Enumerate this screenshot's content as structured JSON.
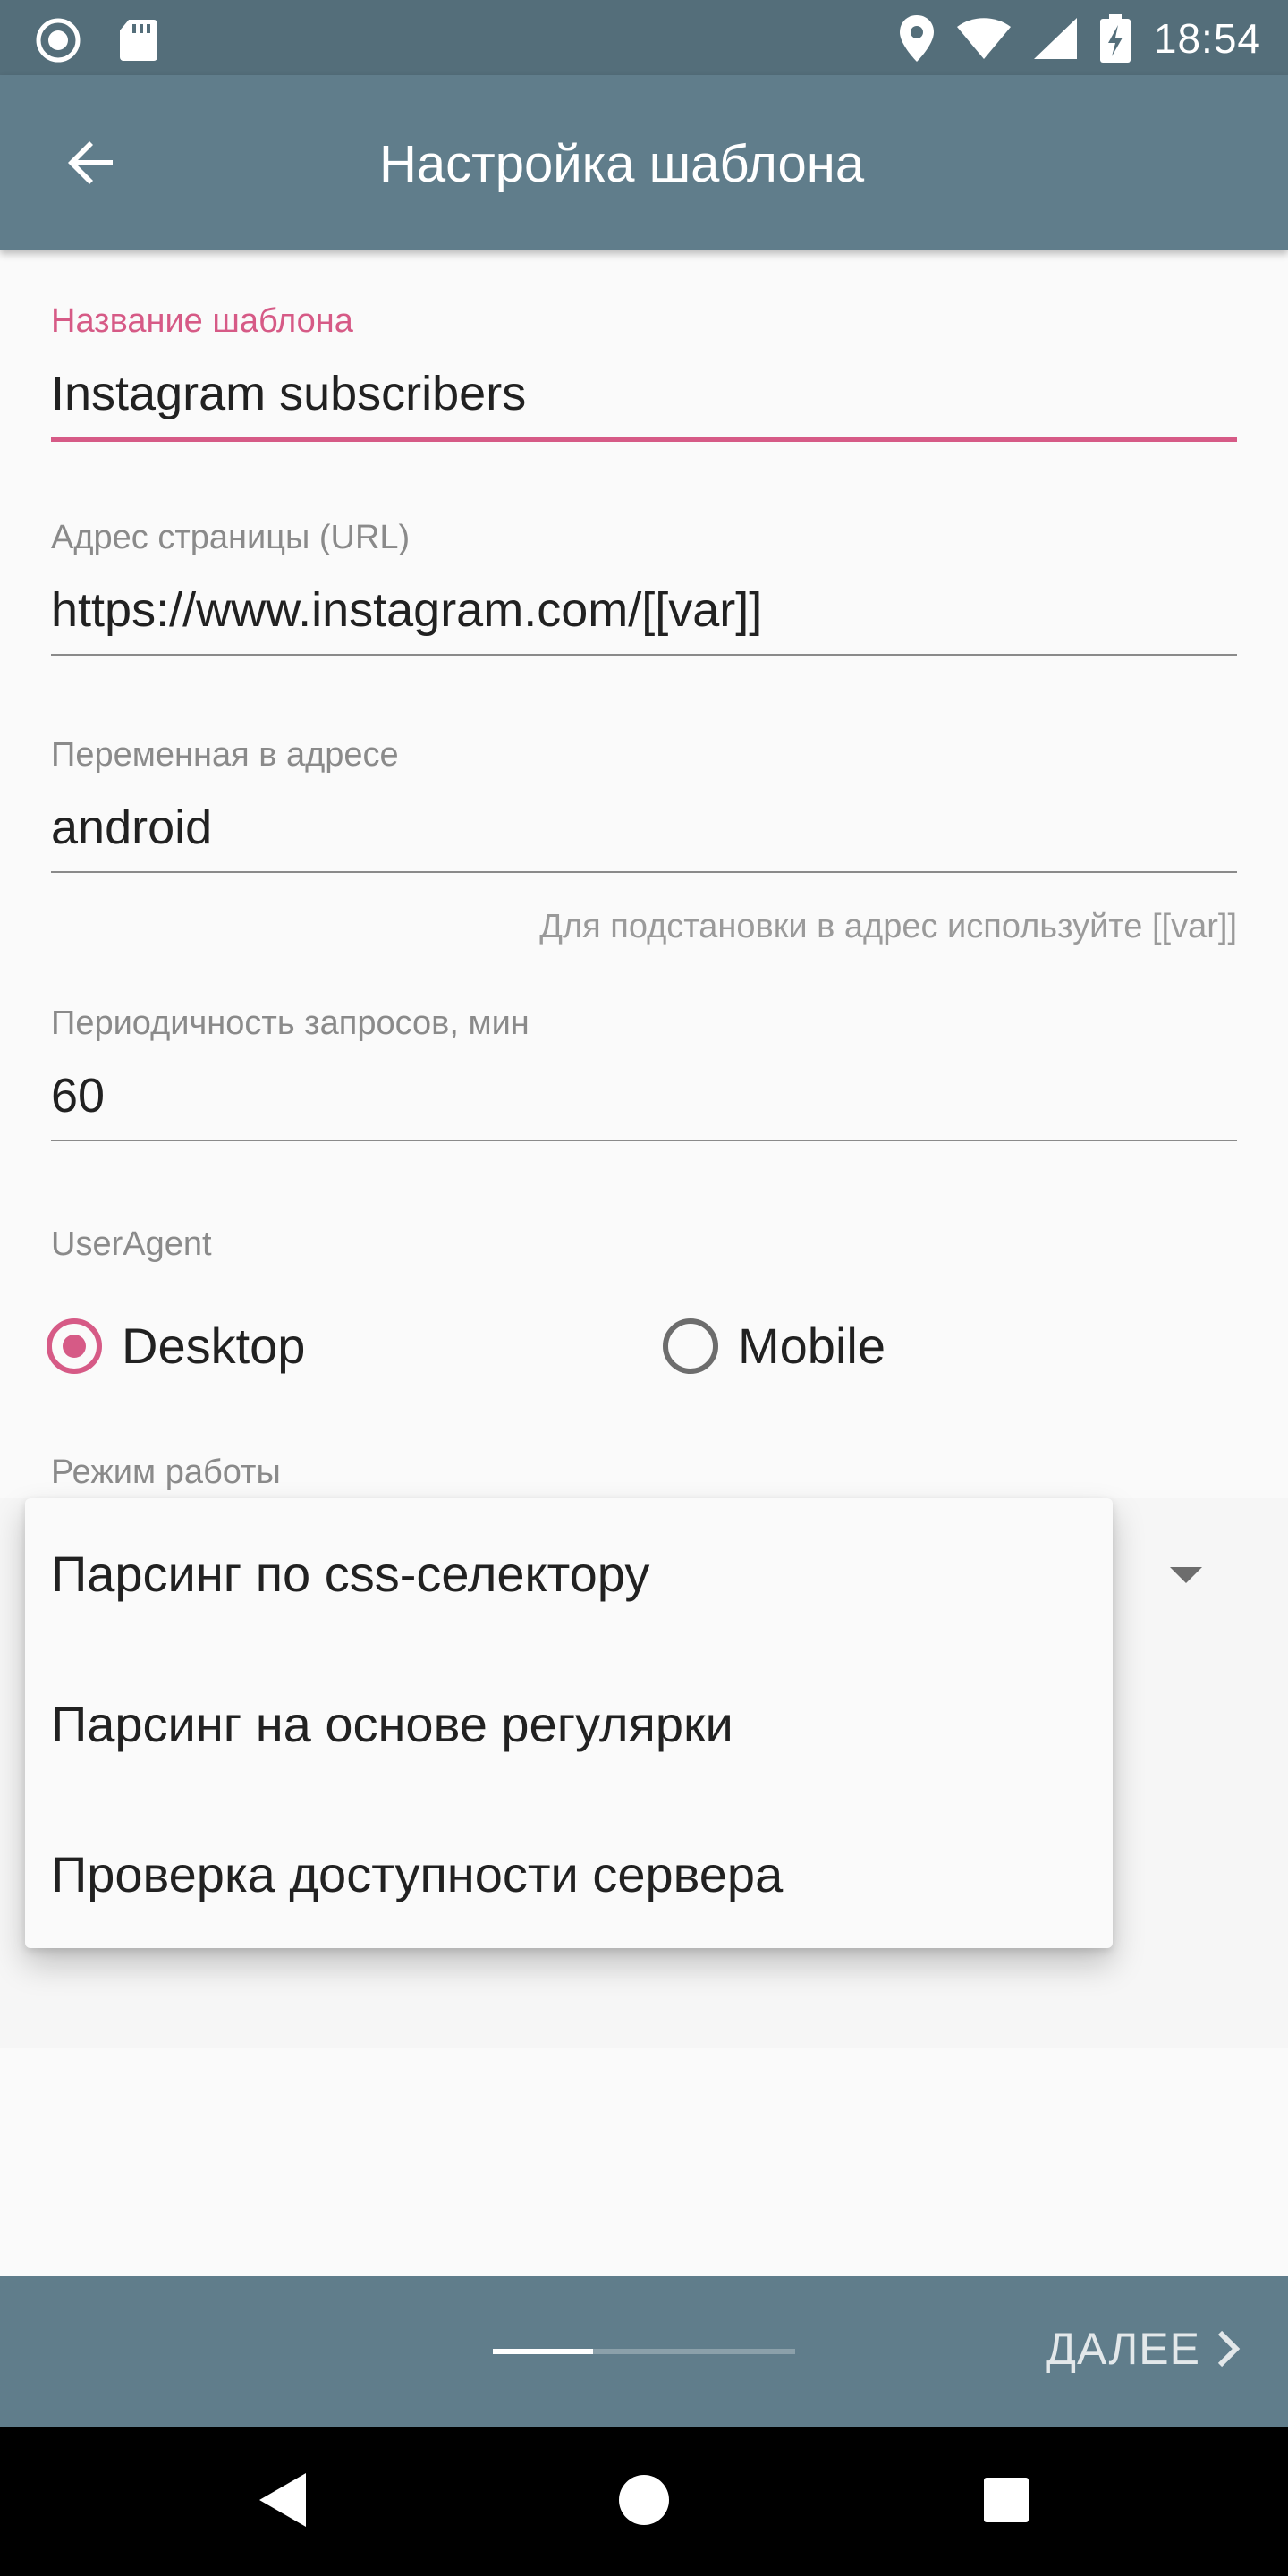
{
  "status_bar": {
    "time": "18:54",
    "left_icons": [
      "record-icon",
      "sd-card-icon"
    ],
    "right_icons": [
      "location-icon",
      "wifi-icon",
      "signal-icon",
      "battery-charging-icon"
    ]
  },
  "app_bar": {
    "title": "Настройка шаблона",
    "back_icon": "arrow-back-icon"
  },
  "form": {
    "template_name": {
      "label": "Название шаблона",
      "value": "Instagram subscribers"
    },
    "page_url": {
      "label": "Адрес страницы (URL)",
      "value": "https://www.instagram.com/[[var]]"
    },
    "url_variable": {
      "label": "Переменная в адресе",
      "value": "android",
      "helper": "Для подстановки в адрес используйте [[var]]"
    },
    "interval": {
      "label": "Периодичность запросов, мин",
      "value": "60"
    },
    "user_agent": {
      "label": "UserAgent",
      "options": [
        {
          "label": "Desktop",
          "checked": true
        },
        {
          "label": "Mobile",
          "checked": false
        }
      ]
    },
    "mode": {
      "label": "Режим работы",
      "menu_items": [
        "Парсинг по css-селектору",
        "Парсинг на основе регулярки",
        "Проверка доступности сервера"
      ]
    }
  },
  "bottom_bar": {
    "next_label": "ДАЛЕЕ",
    "progress": 0.33
  },
  "colors": {
    "accent": "#d65a86",
    "app_bar": "#607d8b",
    "status_bar": "#546e7a"
  }
}
